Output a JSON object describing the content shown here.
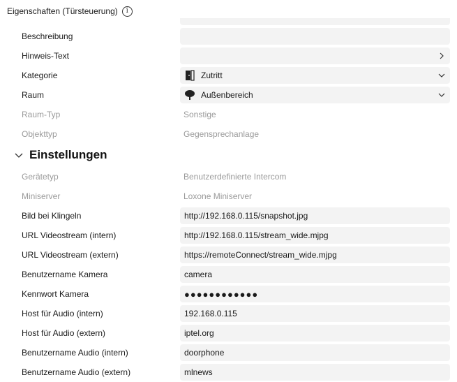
{
  "header": {
    "title": "Eigenschaften (Türsteuerung)"
  },
  "props_top": [
    {
      "label": "Beschreibung",
      "value": "",
      "enabled": true,
      "icon": "",
      "trail": ""
    },
    {
      "label": "Hinweis-Text",
      "value": "",
      "enabled": true,
      "icon": "",
      "trail": "chevron-right"
    },
    {
      "label": "Kategorie",
      "value": "Zutritt",
      "enabled": true,
      "icon": "door-icon",
      "trail": "chevron-down"
    },
    {
      "label": "Raum",
      "value": "Außenbereich",
      "enabled": true,
      "icon": "tree-icon",
      "trail": "chevron-down"
    },
    {
      "label": "Raum-Typ",
      "value": "Sonstige",
      "enabled": false,
      "icon": "",
      "trail": ""
    },
    {
      "label": "Objekttyp",
      "value": "Gegensprechanlage",
      "enabled": false,
      "icon": "",
      "trail": ""
    }
  ],
  "section": {
    "title": "Einstellungen",
    "expanded": true
  },
  "props_settings": [
    {
      "label": "Gerätetyp",
      "value": "Benutzerdefinierte Intercom",
      "enabled": false
    },
    {
      "label": "Miniserver",
      "value": "Loxone Miniserver",
      "enabled": false
    },
    {
      "label": "Bild bei Klingeln",
      "value": "http://192.168.0.115/snapshot.jpg",
      "enabled": true
    },
    {
      "label": "URL Videostream (intern)",
      "value": "http://192.168.0.115/stream_wide.mjpg",
      "enabled": true
    },
    {
      "label": "URL Videostream (extern)",
      "value": "https://remoteConnect/stream_wide.mjpg",
      "enabled": true
    },
    {
      "label": "Benutzername Kamera",
      "value": "camera",
      "enabled": true
    },
    {
      "label": "Kennwort Kamera",
      "value": "●●●●●●●●●●●●",
      "enabled": true
    },
    {
      "label": "Host für Audio (intern)",
      "value": "192.168.0.115",
      "enabled": true
    },
    {
      "label": "Host für Audio (extern)",
      "value": "iptel.org",
      "enabled": true
    },
    {
      "label": "Benutzername Audio (intern)",
      "value": "doorphone",
      "enabled": true
    },
    {
      "label": "Benutzername Audio (extern)",
      "value": "mlnews",
      "enabled": true
    }
  ]
}
